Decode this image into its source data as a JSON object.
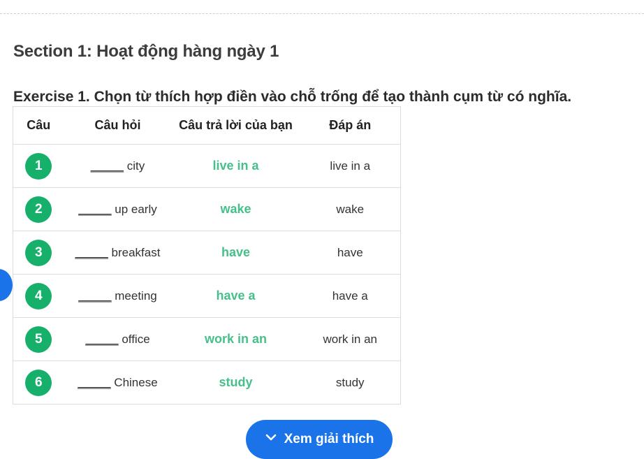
{
  "section": {
    "title": "Section 1: Hoạt động hàng ngày 1"
  },
  "exercise": {
    "title": "Exercise 1. Chọn từ thích hợp điền vào chỗ trống để tạo thành cụm từ có nghĩa."
  },
  "table": {
    "headers": [
      "Câu",
      "Câu hỏi",
      "Câu trả lời của bạn",
      "Đáp án"
    ],
    "rows": [
      {
        "num": "1",
        "blank": "_____",
        "question": " city",
        "your_answer": "live in a",
        "correct": "live in a"
      },
      {
        "num": "2",
        "blank": "_____",
        "question": " up early",
        "your_answer": "wake",
        "correct": "wake"
      },
      {
        "num": "3",
        "blank": "_____",
        "question": " breakfast",
        "your_answer": "have",
        "correct": "have"
      },
      {
        "num": "4",
        "blank": "_____",
        "question": " meeting",
        "your_answer": "have a",
        "correct": "have a"
      },
      {
        "num": "5",
        "blank": "_____",
        "question": " office",
        "your_answer": "work in an",
        "correct": "work in an"
      },
      {
        "num": "6",
        "blank": "_____",
        "question": " Chinese",
        "your_answer": "study",
        "correct": "study"
      }
    ]
  },
  "explain_button": {
    "label": "Xem giải thích",
    "icon": "chevron-down-icon"
  },
  "colors": {
    "accent_blue": "#1a73e8",
    "badge_green": "#17b06b",
    "answer_green": "#46c08a"
  }
}
